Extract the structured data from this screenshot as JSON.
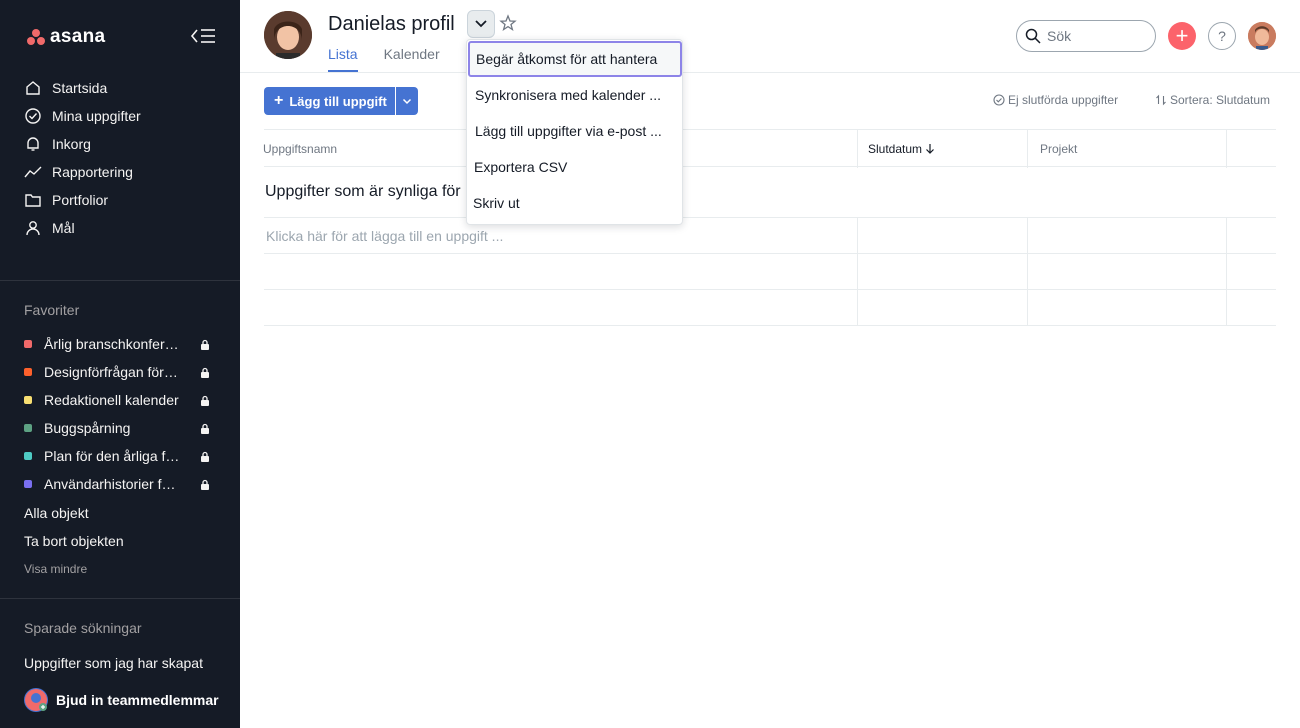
{
  "sidebar": {
    "logo_text": "asana",
    "nav": [
      {
        "label": "Startsida",
        "icon": "home-icon"
      },
      {
        "label": "Mina uppgifter",
        "icon": "check-circle-icon"
      },
      {
        "label": "Inkorg",
        "icon": "bell-icon"
      },
      {
        "label": "Rapportering",
        "icon": "trend-line-icon"
      },
      {
        "label": "Portfolior",
        "icon": "folder-icon"
      },
      {
        "label": "Mål",
        "icon": "person-icon"
      }
    ],
    "favorites_title": "Favoriter",
    "favorites": [
      {
        "label": "Årlig branschkonferens",
        "color": "#f06a6a"
      },
      {
        "label": "Designförfrågan för webbplats",
        "color": "#fd612c"
      },
      {
        "label": "Redaktionell kalender",
        "color": "#f8df72"
      },
      {
        "label": "Buggspårning",
        "color": "#5da283"
      },
      {
        "label": "Plan för den årliga försäljningskonferensen",
        "color": "#4ecbc4"
      },
      {
        "label": "Användarhistorier för produkt",
        "color": "#7a6ff0"
      }
    ],
    "all_objects": "Alla objekt",
    "remove_objects": "Ta bort objekten",
    "show_less": "Visa mindre",
    "saved_searches_title": "Sparade sökningar",
    "saved_search_item": "Uppgifter som jag har skapat",
    "invite_label": "Bjud in teammedlemmar"
  },
  "header": {
    "title": "Danielas profil",
    "tabs": [
      {
        "label": "Lista",
        "active": true
      },
      {
        "label": "Kalender",
        "active": false
      }
    ],
    "search_placeholder": "Sök",
    "help_label": "?",
    "plus_label": "+"
  },
  "toolbar": {
    "add_task_label": "Lägg till uppgift",
    "filter_label": "Ej slutförda uppgifter",
    "sort_label": "Sortera: Slutdatum"
  },
  "table": {
    "columns": [
      "Uppgiftsnamn",
      "Slutdatum",
      "Projekt"
    ],
    "section_title": "Uppgifter som är synliga för mig",
    "add_task_placeholder": "Klicka här för att lägga till en uppgift ..."
  },
  "menu": {
    "items": [
      "Begär åtkomst för att hantera",
      "Synkronisera med kalender ...",
      "Lägg till uppgifter via e-post ...",
      "Exportera CSV",
      "Skriv ut"
    ]
  },
  "colors": {
    "sidebar_bg": "#151b26",
    "accent": "#4573d2",
    "menu_focus": "#8d84e8",
    "plus_button": "#fc636b"
  }
}
